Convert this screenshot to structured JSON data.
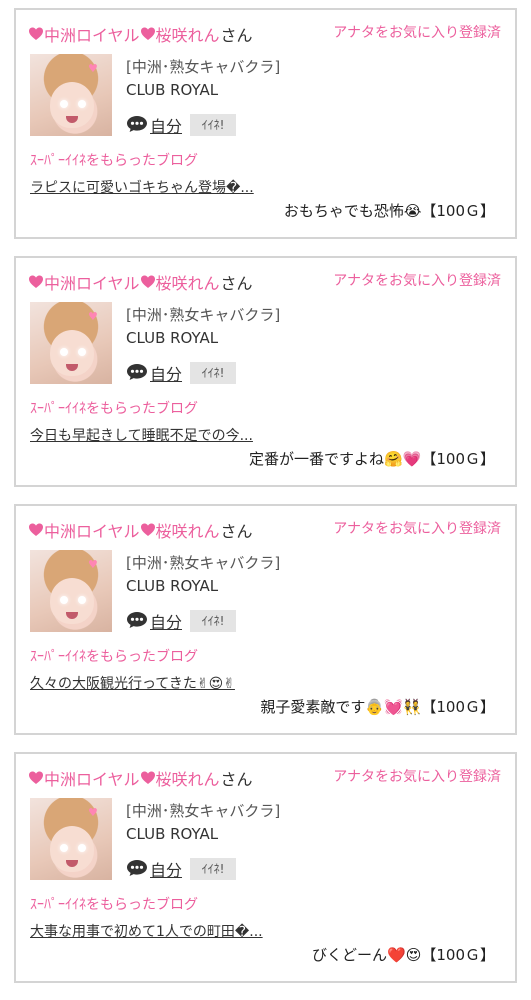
{
  "colors": {
    "accent": "#ec5f9d",
    "border": "#d4d4d4",
    "button_bg": "#e4e4e4"
  },
  "cards": [
    {
      "name_part1": "中洲ロイヤル",
      "name_part2": "桜咲れん",
      "honorific": "さん",
      "favorite_link": "アナタをお気に入り登録済",
      "shop": "[中洲･熟女キャバクラ]",
      "club": "CLUB ROYAL",
      "self_link": "自分",
      "iine_button": "ｲｲﾈ!",
      "blog_label": "ｽｰﾊﾟｰｲｲﾈをもらったブログ",
      "blog_title": "ラピスに可愛いゴキちゃん登場�...",
      "comment": "おもちゃでも恐怖😭【100Ｇ】"
    },
    {
      "name_part1": "中洲ロイヤル",
      "name_part2": "桜咲れん",
      "honorific": "さん",
      "favorite_link": "アナタをお気に入り登録済",
      "shop": "[中洲･熟女キャバクラ]",
      "club": "CLUB ROYAL",
      "self_link": "自分",
      "iine_button": "ｲｲﾈ!",
      "blog_label": "ｽｰﾊﾟｰｲｲﾈをもらったブログ",
      "blog_title": "今日も早起きして睡眠不足での今...",
      "comment": "定番が一番ですよね🤗💗【100Ｇ】"
    },
    {
      "name_part1": "中洲ロイヤル",
      "name_part2": "桜咲れん",
      "honorific": "さん",
      "favorite_link": "アナタをお気に入り登録済",
      "shop": "[中洲･熟女キャバクラ]",
      "club": "CLUB ROYAL",
      "self_link": "自分",
      "iine_button": "ｲｲﾈ!",
      "blog_label": "ｽｰﾊﾟｰｲｲﾈをもらったブログ",
      "blog_title": "久々の大阪観光行ってきた✌😍✌",
      "comment": "親子愛素敵です👵💓👯【100Ｇ】"
    },
    {
      "name_part1": "中洲ロイヤル",
      "name_part2": "桜咲れん",
      "honorific": "さん",
      "favorite_link": "アナタをお気に入り登録済",
      "shop": "[中洲･熟女キャバクラ]",
      "club": "CLUB ROYAL",
      "self_link": "自分",
      "iine_button": "ｲｲﾈ!",
      "blog_label": "ｽｰﾊﾟｰｲｲﾈをもらったブログ",
      "blog_title": "大事な用事で初めて1人での町田�...",
      "comment": "びくどーん❤️😍【100Ｇ】"
    }
  ]
}
